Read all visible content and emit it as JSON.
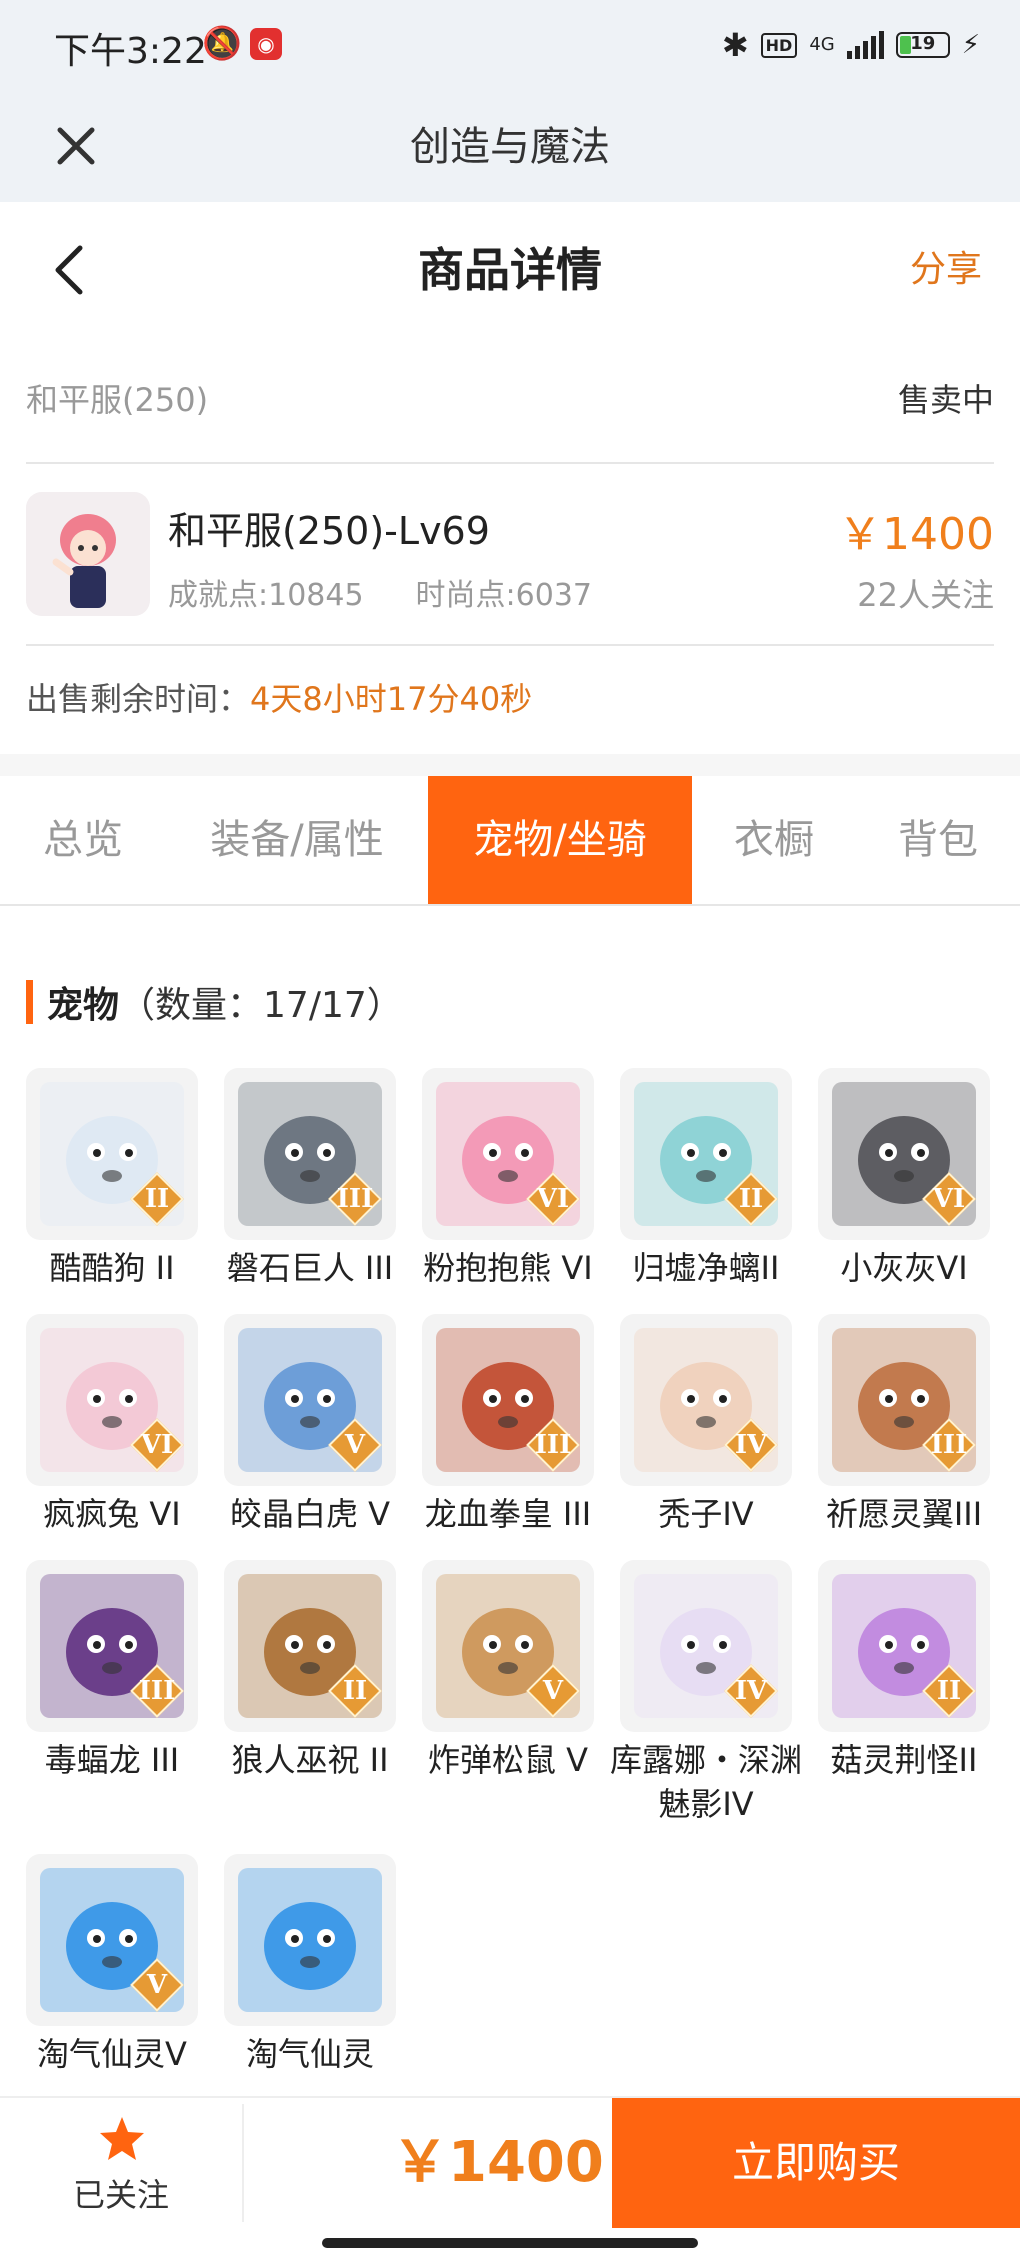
{
  "status_bar": {
    "time": "下午3:22",
    "icons": [
      "mute-bell-icon",
      "app-notification-icon",
      "bluetooth-icon",
      "hd-icon",
      "4g-signal-icon",
      "battery-icon",
      "charging-icon"
    ],
    "hd": "HD",
    "network": "4G",
    "battery": "19"
  },
  "topbar": {
    "title": "创造与魔法",
    "close_icon": "close-icon"
  },
  "navbar": {
    "title": "商品详情",
    "share_label": "分享",
    "back_icon": "chevron-left-icon"
  },
  "listing": {
    "server": "和平服(250)",
    "sale_status": "售卖中",
    "role_name": "和平服(250)-Lv69",
    "achievement": "成就点:10845",
    "fashion": "时尚点:6037",
    "price": "￥1400",
    "followers": "22人关注",
    "remaining_label": "出售剩余时间：",
    "remaining_value": "4天8小时17分40秒"
  },
  "tabs": [
    {
      "label": "总览",
      "active": false
    },
    {
      "label": "装备/属性",
      "active": false
    },
    {
      "label": "宠物/坐骑",
      "active": true
    },
    {
      "label": "衣橱",
      "active": false
    },
    {
      "label": "背包",
      "active": false
    }
  ],
  "pets_section": {
    "title": "宠物",
    "count": "（数量：17/17）"
  },
  "pets": [
    {
      "name": "酷酷狗 II",
      "rank": "II",
      "color": "#dfe9f3"
    },
    {
      "name": "磐石巨人 III",
      "rank": "III",
      "color": "#6e7782"
    },
    {
      "name": "粉抱抱熊 VI",
      "rank": "VI",
      "color": "#f39ab7"
    },
    {
      "name": "归墟净螭II",
      "rank": "II",
      "color": "#8fd3d6"
    },
    {
      "name": "小灰灰VI",
      "rank": "VI",
      "color": "#5d5d62"
    },
    {
      "name": "疯疯兔 VI",
      "rank": "VI",
      "color": "#f3c9d6"
    },
    {
      "name": "皎晶白虎 V",
      "rank": "V",
      "color": "#6d9ed8"
    },
    {
      "name": "龙血拳皇 III",
      "rank": "III",
      "color": "#c4553a"
    },
    {
      "name": "秃子IV",
      "rank": "IV",
      "color": "#f0d2be"
    },
    {
      "name": "祈愿灵翼III",
      "rank": "III",
      "color": "#c27a4e"
    },
    {
      "name": "毒蝠龙 III",
      "rank": "III",
      "color": "#6b3f8a"
    },
    {
      "name": "狼人巫祝 II",
      "rank": "II",
      "color": "#b07840"
    },
    {
      "name": "炸弹松鼠 V",
      "rank": "V",
      "color": "#cf9a5f"
    },
    {
      "name": "库露娜・深渊魅影IV",
      "rank": "IV",
      "color": "#e7ddf3"
    },
    {
      "name": "菇灵荆怪II",
      "rank": "II",
      "color": "#c28ce0"
    },
    {
      "name": "淘气仙灵V",
      "rank": "V",
      "color": "#3f9ae8"
    },
    {
      "name": "淘气仙灵",
      "rank": "",
      "color": "#3f9ae8"
    }
  ],
  "bottom": {
    "follow_label": "已关注",
    "follow_icon": "star-icon",
    "price": "￥1400",
    "buy_label": "立即购买"
  },
  "colors": {
    "accent": "#ff6410",
    "price": "#f07f1c",
    "share": "#e0761c",
    "badge": "#e69a34"
  }
}
